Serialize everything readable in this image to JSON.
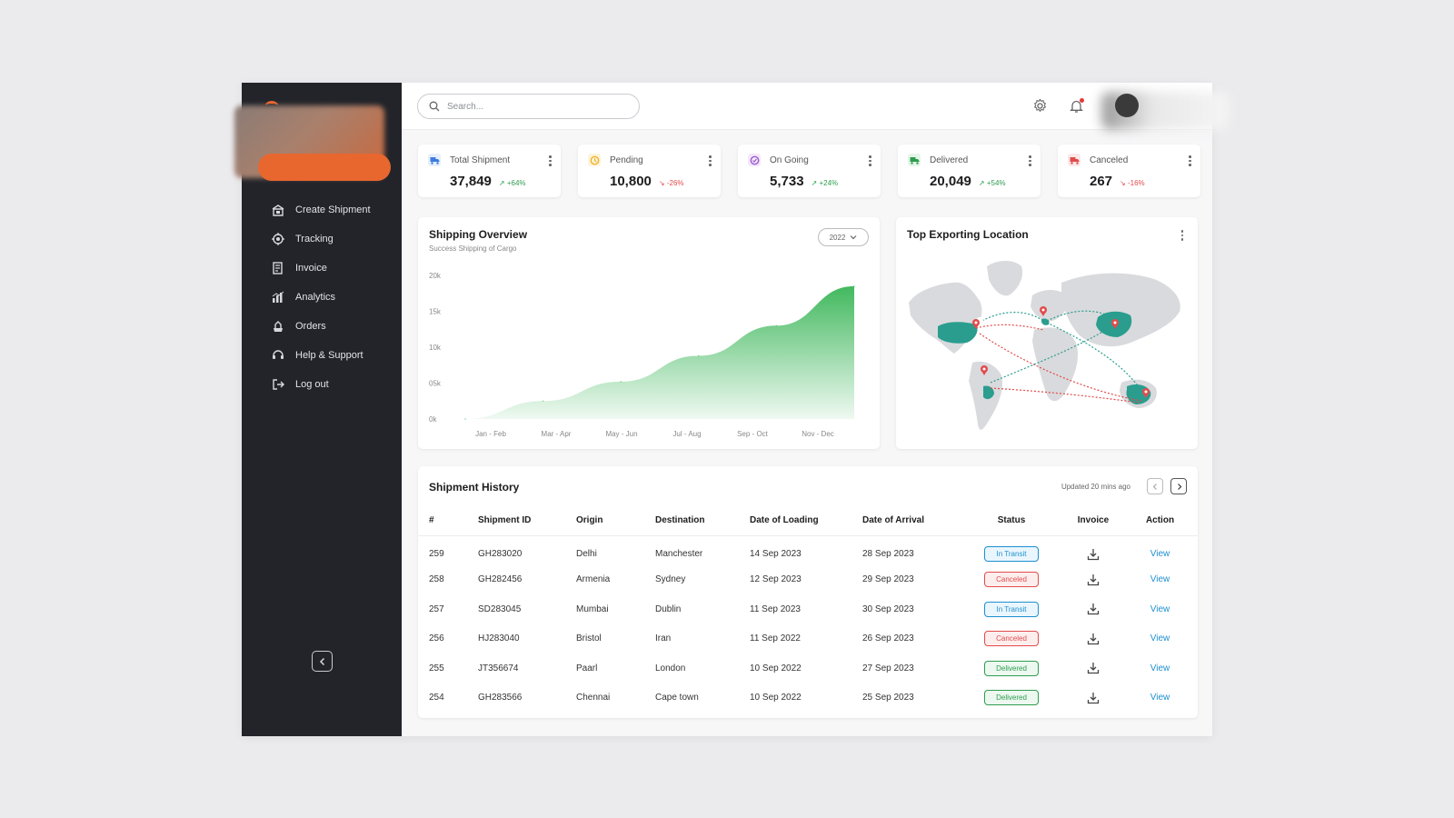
{
  "sidebar": {
    "items": [
      {
        "label": "Create Shipment",
        "icon": "box-icon"
      },
      {
        "label": "Tracking",
        "icon": "target-icon"
      },
      {
        "label": "Invoice",
        "icon": "invoice-icon"
      },
      {
        "label": "Analytics",
        "icon": "analytics-icon"
      },
      {
        "label": "Orders",
        "icon": "orders-icon"
      },
      {
        "label": "Help & Support",
        "icon": "headset-icon"
      },
      {
        "label": "Log out",
        "icon": "logout-icon"
      }
    ]
  },
  "topbar": {
    "search_placeholder": "Search..."
  },
  "stats": [
    {
      "label": "Total Shipment",
      "value": "37,849",
      "change": "+64%",
      "trend": "up",
      "color": "#3d7be0"
    },
    {
      "label": "Pending",
      "value": "10,800",
      "change": "-26%",
      "trend": "down",
      "color": "#f0b429"
    },
    {
      "label": "On Going",
      "value": "5,733",
      "change": "+24%",
      "trend": "up",
      "color": "#9b59d0"
    },
    {
      "label": "Delivered",
      "value": "20,049",
      "change": "+54%",
      "trend": "up",
      "color": "#2e9d4f"
    },
    {
      "label": "Canceled",
      "value": "267",
      "change": "-16%",
      "trend": "down",
      "color": "#e24b4b"
    }
  ],
  "overview": {
    "title": "Shipping Overview",
    "subtitle": "Success Shipping of Cargo",
    "year": "2022"
  },
  "chart_data": {
    "type": "area",
    "x": [
      "Jan - Feb",
      "Mar - Apr",
      "May - Jun",
      "Jul - Aug",
      "Sep - Oct",
      "Nov - Dec"
    ],
    "values": [
      0,
      2500,
      5200,
      8800,
      13000,
      18500
    ],
    "ylim": [
      0,
      20000
    ],
    "y_ticks": [
      0,
      5000,
      10000,
      15000,
      20000
    ],
    "y_tick_labels": [
      "0k",
      "05k",
      "10k",
      "15k",
      "20k"
    ],
    "grid": false,
    "color": "#3cc05c"
  },
  "map": {
    "title": "Top Exporting Location"
  },
  "history": {
    "title": "Shipment History",
    "updated": "Updated 20 mins ago",
    "columns": [
      "#",
      "Shipment ID",
      "Origin",
      "Destination",
      "Date of Loading",
      "Date of Arrival",
      "Status",
      "Invoice",
      "Action"
    ],
    "rows": [
      {
        "num": "259",
        "id": "GH283020",
        "origin": "Delhi",
        "dest": "Manchester",
        "loading": "14 Sep 2023",
        "arrival": "28 Sep 2023",
        "status": "In Transit",
        "action": "View"
      },
      {
        "num": "258",
        "id": "GH282456",
        "origin": "Armenia",
        "dest": "Sydney",
        "loading": "12 Sep 2023",
        "arrival": "29 Sep 2023",
        "status": "Canceled",
        "action": "View"
      },
      {
        "num": "257",
        "id": "SD283045",
        "origin": "Mumbai",
        "dest": "Dublin",
        "loading": "11 Sep 2023",
        "arrival": "30 Sep 2023",
        "status": "In Transit",
        "action": "View"
      },
      {
        "num": "256",
        "id": "HJ283040",
        "origin": "Bristol",
        "dest": "Iran",
        "loading": "11 Sep 2022",
        "arrival": "26 Sep 2023",
        "status": "Canceled",
        "action": "View"
      },
      {
        "num": "255",
        "id": "JT356674",
        "origin": "Paarl",
        "dest": "London",
        "loading": "10 Sep 2022",
        "arrival": "27 Sep 2023",
        "status": "Delivered",
        "action": "View"
      },
      {
        "num": "254",
        "id": "GH283566",
        "origin": "Chennai",
        "dest": "Cape town",
        "loading": "10 Sep 2022",
        "arrival": "25 Sep 2023",
        "status": "Delivered",
        "action": "View"
      }
    ]
  }
}
